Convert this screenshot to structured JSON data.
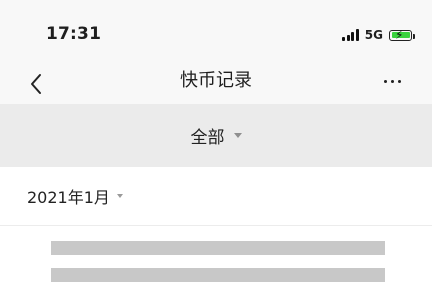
{
  "status_bar": {
    "time": "17:31",
    "network": "5G",
    "battery_icon": "battery-charging-icon",
    "signal_icon": "signal-bars-icon",
    "battery_color": "#3ad23e"
  },
  "nav": {
    "title": "快币记录",
    "back_icon": "chevron-left-icon",
    "more_icon": "more-horizontal-icon"
  },
  "filter": {
    "label": "全部",
    "caret_icon": "caret-down-icon"
  },
  "month": {
    "label": "2021年1月",
    "caret_icon": "caret-down-icon"
  },
  "colors": {
    "header_bg": "#f8f8f8",
    "filter_bg": "#ebebeb",
    "placeholder": "#c8c8c8"
  }
}
